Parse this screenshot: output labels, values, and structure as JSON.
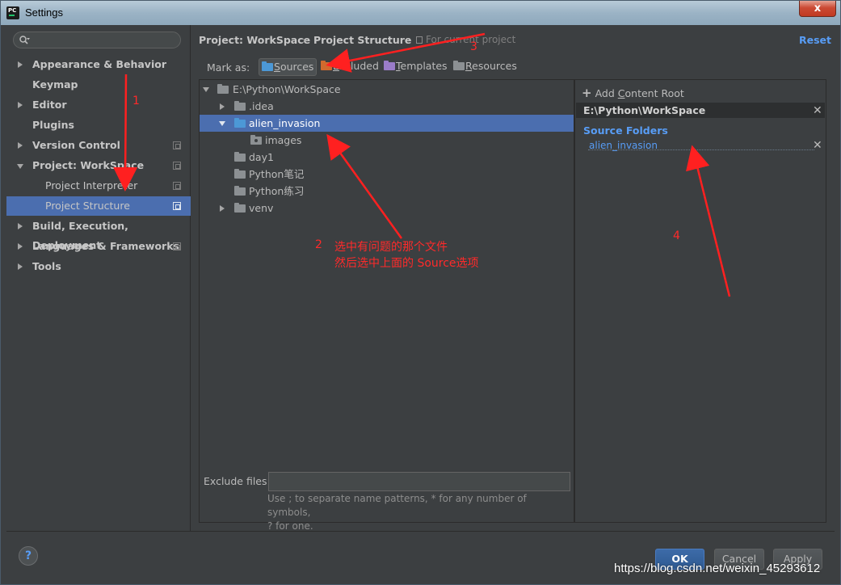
{
  "window": {
    "title": "Settings",
    "close_glyph": "x"
  },
  "sidebar": {
    "search_placeholder": "",
    "items": [
      {
        "label": "Appearance & Behavior",
        "expandable": true,
        "expanded": false
      },
      {
        "label": "Keymap",
        "expandable": false
      },
      {
        "label": "Editor",
        "expandable": true,
        "expanded": false
      },
      {
        "label": "Plugins",
        "expandable": false
      },
      {
        "label": "Version Control",
        "expandable": true,
        "expanded": false
      },
      {
        "label": "Project: WorkSpace",
        "expandable": true,
        "expanded": true
      },
      {
        "label": "Project Interpreter",
        "sub": true
      },
      {
        "label": "Project Structure",
        "sub": true,
        "selected": true
      },
      {
        "label": "Build, Execution, Deployment",
        "expandable": true,
        "expanded": false
      },
      {
        "label": "Languages & Frameworks",
        "expandable": true,
        "expanded": false
      },
      {
        "label": "Tools",
        "expandable": true,
        "expanded": false
      }
    ]
  },
  "header": {
    "crumb_1": "Project: WorkSpace",
    "separator": "›",
    "crumb_2": "Project Structure",
    "note": "For current project",
    "reset": "Reset"
  },
  "markas": {
    "label": "Mark as:",
    "sources_first": "S",
    "sources_rest": "ources",
    "excluded_first": "E",
    "excluded_rest": "xcluded",
    "templates_first": "T",
    "templates_rest": "emplates",
    "resources_first": "R",
    "resources_rest": "esources",
    "colors": {
      "sources": "#4c98d6",
      "excluded": "#d06a2e",
      "templates": "#9a7cc8",
      "resources": "#8c9093"
    }
  },
  "tree": {
    "root": "E:\\Python\\WorkSpace",
    "idea": ".idea",
    "alien": "alien_invasion",
    "images": "images",
    "day1": "day1",
    "notes": "Python笔记",
    "practice": "Python练习",
    "venv": "venv"
  },
  "exclude": {
    "label": "Exclude files:",
    "value": "",
    "help_line1": "Use ; to separate name patterns, * for any number of symbols,",
    "help_line2": "? for one."
  },
  "roots": {
    "add_prefix": "Add ",
    "add_first": "C",
    "add_rest": "ontent Root",
    "path": "E:\\Python\\WorkSpace",
    "source_folders": "Source Folders",
    "source_item": "alien_invasion"
  },
  "footer": {
    "help": "?",
    "ok": "OK",
    "cancel": "Cancel",
    "apply": "Apply"
  },
  "annotations": {
    "n1": "1",
    "n2": "2",
    "n3": "3",
    "n4": "4",
    "note_line1": "选中有问题的那个文件",
    "note_line2": "然后选中上面的  Source选项"
  },
  "watermark": "https://blog.csdn.net/weixin_45293612"
}
